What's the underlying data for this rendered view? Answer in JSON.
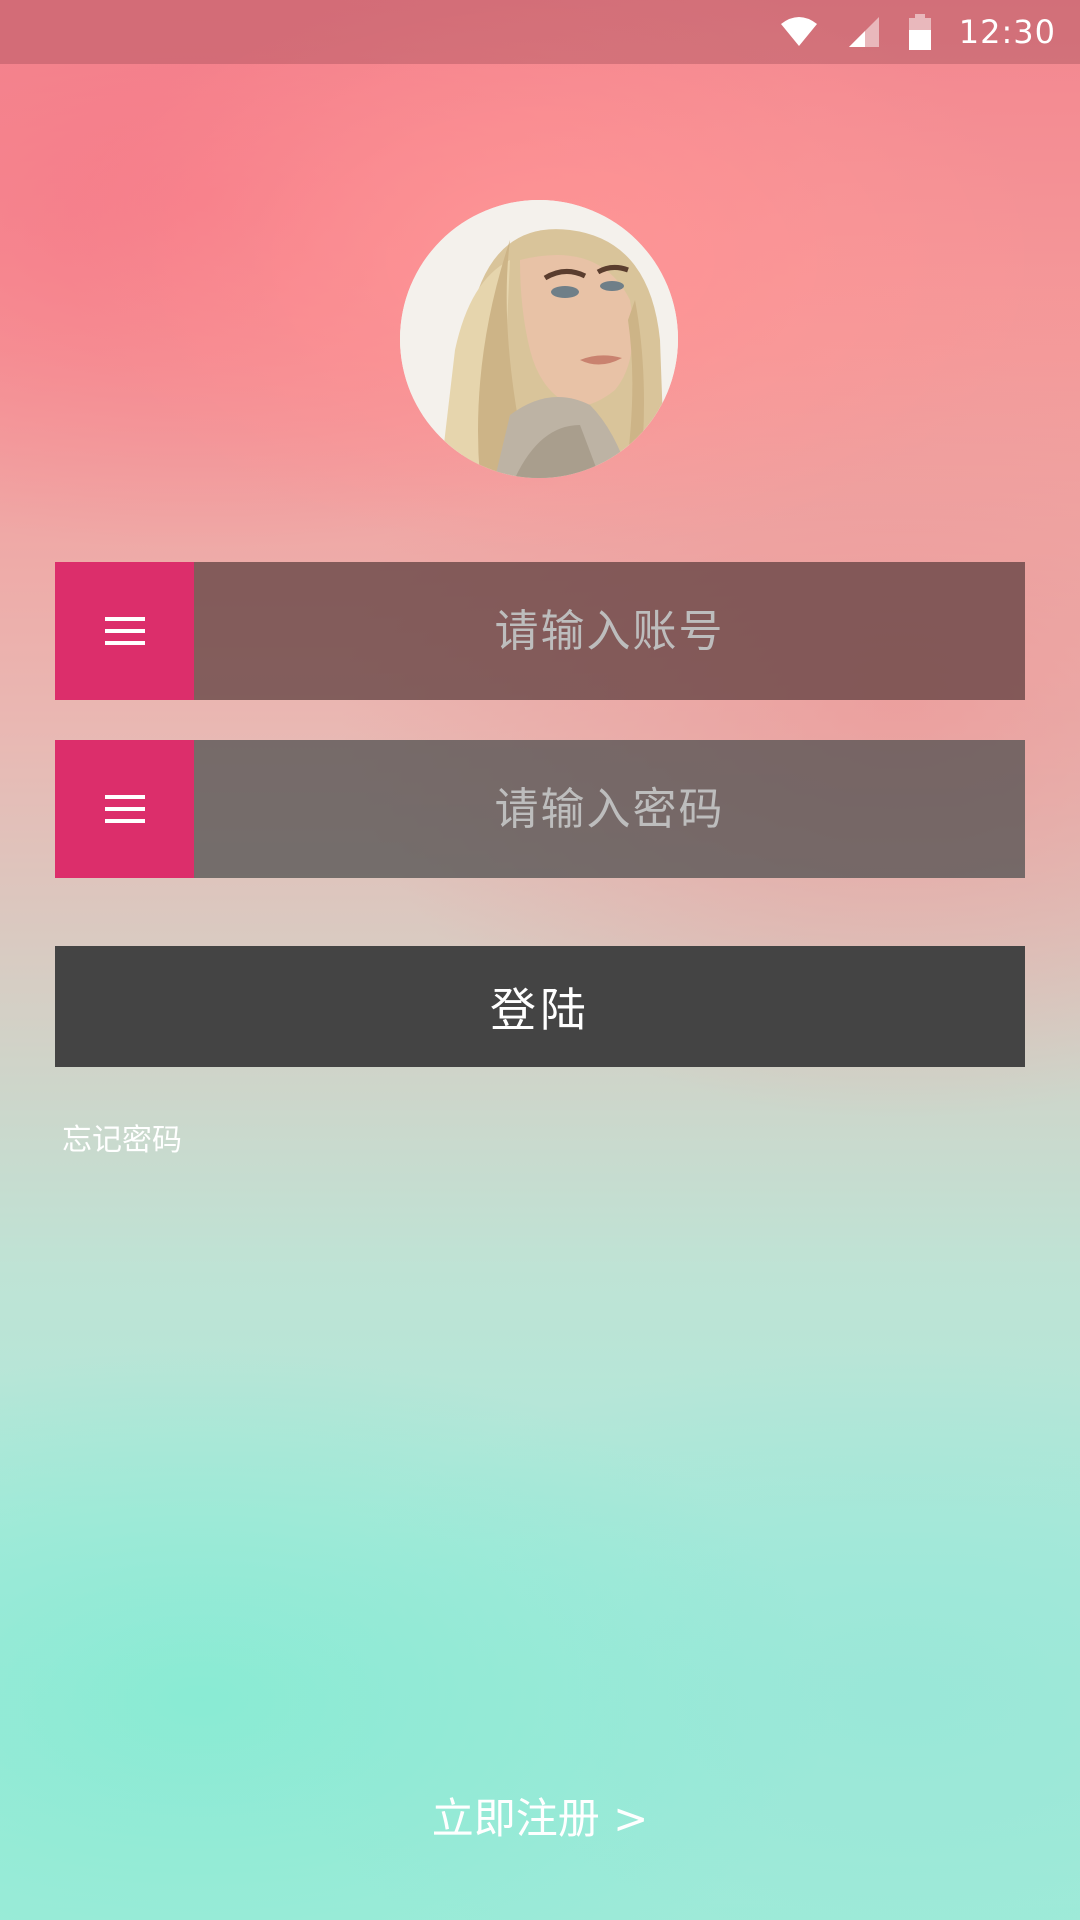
{
  "status_bar": {
    "time": "12:30",
    "icons": [
      "wifi-icon",
      "signal-icon",
      "battery-icon"
    ]
  },
  "avatar": {
    "icon": "user-avatar-photo"
  },
  "account_input": {
    "placeholder": "请输入账号",
    "value": "",
    "icon": "menu-icon",
    "icon_bg": "#dc2e6b"
  },
  "password_input": {
    "placeholder": "请输入密码",
    "value": "",
    "icon": "menu-icon",
    "icon_bg": "#dc2e6b"
  },
  "login_button": {
    "label": "登陆",
    "bg": "#444444"
  },
  "forgot_password": {
    "label": "忘记密码"
  },
  "register": {
    "label": "立即注册 >"
  }
}
